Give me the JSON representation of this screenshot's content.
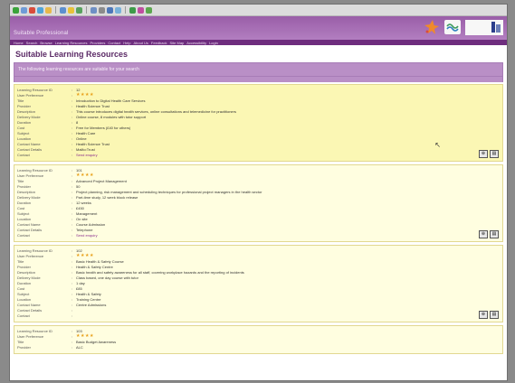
{
  "header": {
    "site_name": "Suitable Professional"
  },
  "nav": {
    "items": [
      "Home",
      "Search",
      "Browse",
      "Learning Resources",
      "Providers",
      "Contact",
      "Help",
      "About Us",
      "Feedback",
      "Site Map",
      "Accessibility",
      "Login"
    ]
  },
  "page": {
    "title": "Suitable Learning Resources",
    "intro": "The following learning resources are suitable for your search"
  },
  "labels": {
    "id": "Learning Resource ID",
    "rating": "User Preference",
    "title": "Title",
    "provider": "Provider",
    "description": "Description",
    "delivery": "Delivery Mode",
    "duration": "Duration",
    "cost": "Cost",
    "subject": "Subject",
    "location": "Location",
    "contact_name": "Contact Name",
    "contact_details": "Contact Details",
    "contact": "Contact"
  },
  "records": [
    {
      "rating": "★★★★",
      "id": "12",
      "title": "Introduction to Digital Health Care Services",
      "provider": "Health Science Trust",
      "description": "This course introduces digital health services, online consultations and telemedicine for practitioners",
      "delivery": "Online course, 8 modules with tutor support",
      "duration": "8",
      "cost": "Free for Members (£40 for others)",
      "subject": "Health Care",
      "location": "Online",
      "contact_name": "Health Science Trust",
      "contact_details": "Mailto:Trust",
      "contact": "Send enquiry"
    },
    {
      "rating": "★★★★",
      "id": "101",
      "title": "Advanced Project Management",
      "provider": "50",
      "description": "Project planning, risk management and scheduling techniques for professional project managers in the health sector",
      "delivery": "Part-time study, 12 week block release",
      "duration": "12 weeks",
      "cost": "£450",
      "subject": "Management",
      "location": "On site",
      "contact_name": "Course Admission",
      "contact_details": "Telephone",
      "contact": "Send enquiry"
    },
    {
      "rating": "★★★★",
      "id": "102",
      "title": "Basic Health & Safety Course",
      "provider": "Health & Safety Centre",
      "description": "Basic health and safety awareness for all staff, covering workplace hazards and the reporting of incidents",
      "delivery": "Class based, one day course with tutor",
      "duration": "1 day",
      "cost": "£85",
      "subject": "Health & Safety",
      "location": "Training Centre",
      "contact_name": "Centre Admissions",
      "contact_details": "",
      "contact": ""
    },
    {
      "rating": "★★★★",
      "id": "103",
      "title": "Basic Budget Awareness",
      "provider": "ALC"
    }
  ],
  "icons": {
    "action_1": "⊕",
    "action_2": "▤"
  }
}
